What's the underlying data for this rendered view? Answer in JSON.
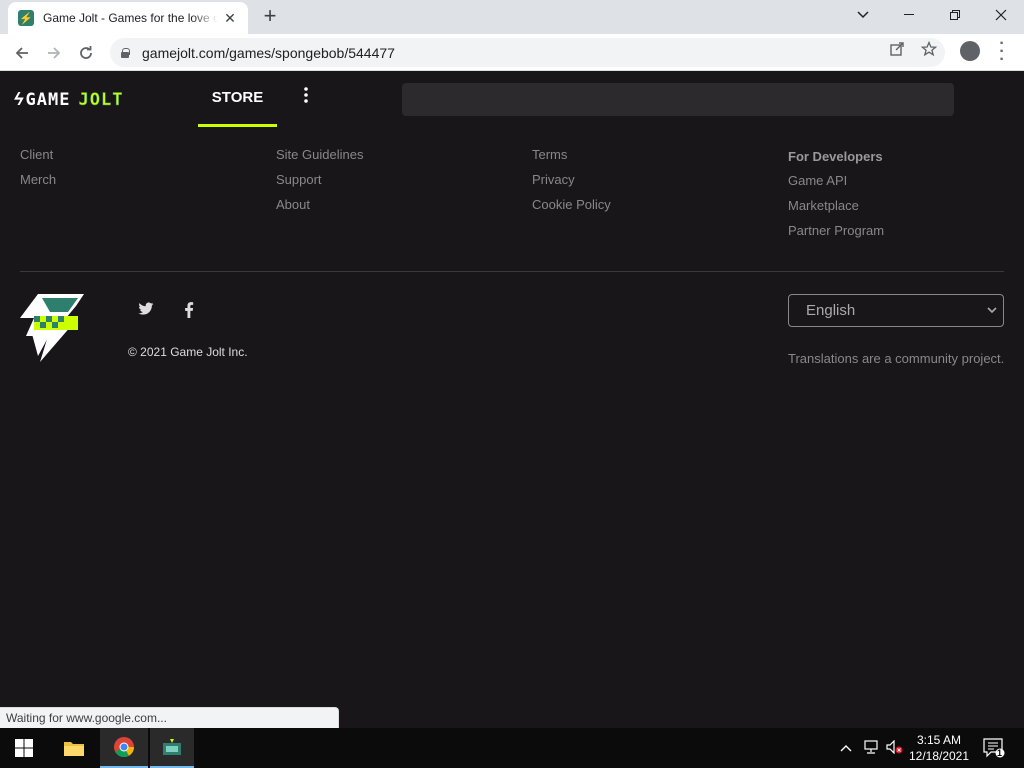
{
  "browser": {
    "tab_title": "Game Jolt - Games for the love of",
    "url": "gamejolt.com/games/spongebob/544477",
    "status": "Waiting for www.google.com..."
  },
  "site": {
    "nav_store": "STORE",
    "logo_game": "GAME",
    "logo_jolt": "JOLT"
  },
  "footer": {
    "col1": [
      "Client",
      "Merch"
    ],
    "col2": [
      "Site Guidelines",
      "Support",
      "About"
    ],
    "col3": [
      "Terms",
      "Privacy",
      "Cookie Policy"
    ],
    "col4_heading": "For Developers",
    "col4": [
      "Game API",
      "Marketplace",
      "Partner Program"
    ],
    "copyright": "© 2021 Game Jolt Inc.",
    "language": "English",
    "translations_note": "Translations are a community project."
  },
  "taskbar": {
    "time": "3:15 AM",
    "date": "12/18/2021",
    "notification_count": "1"
  },
  "colors": {
    "accent": "#ccff00",
    "page_bg": "#191619",
    "brand_green": "#2f7f6f"
  }
}
